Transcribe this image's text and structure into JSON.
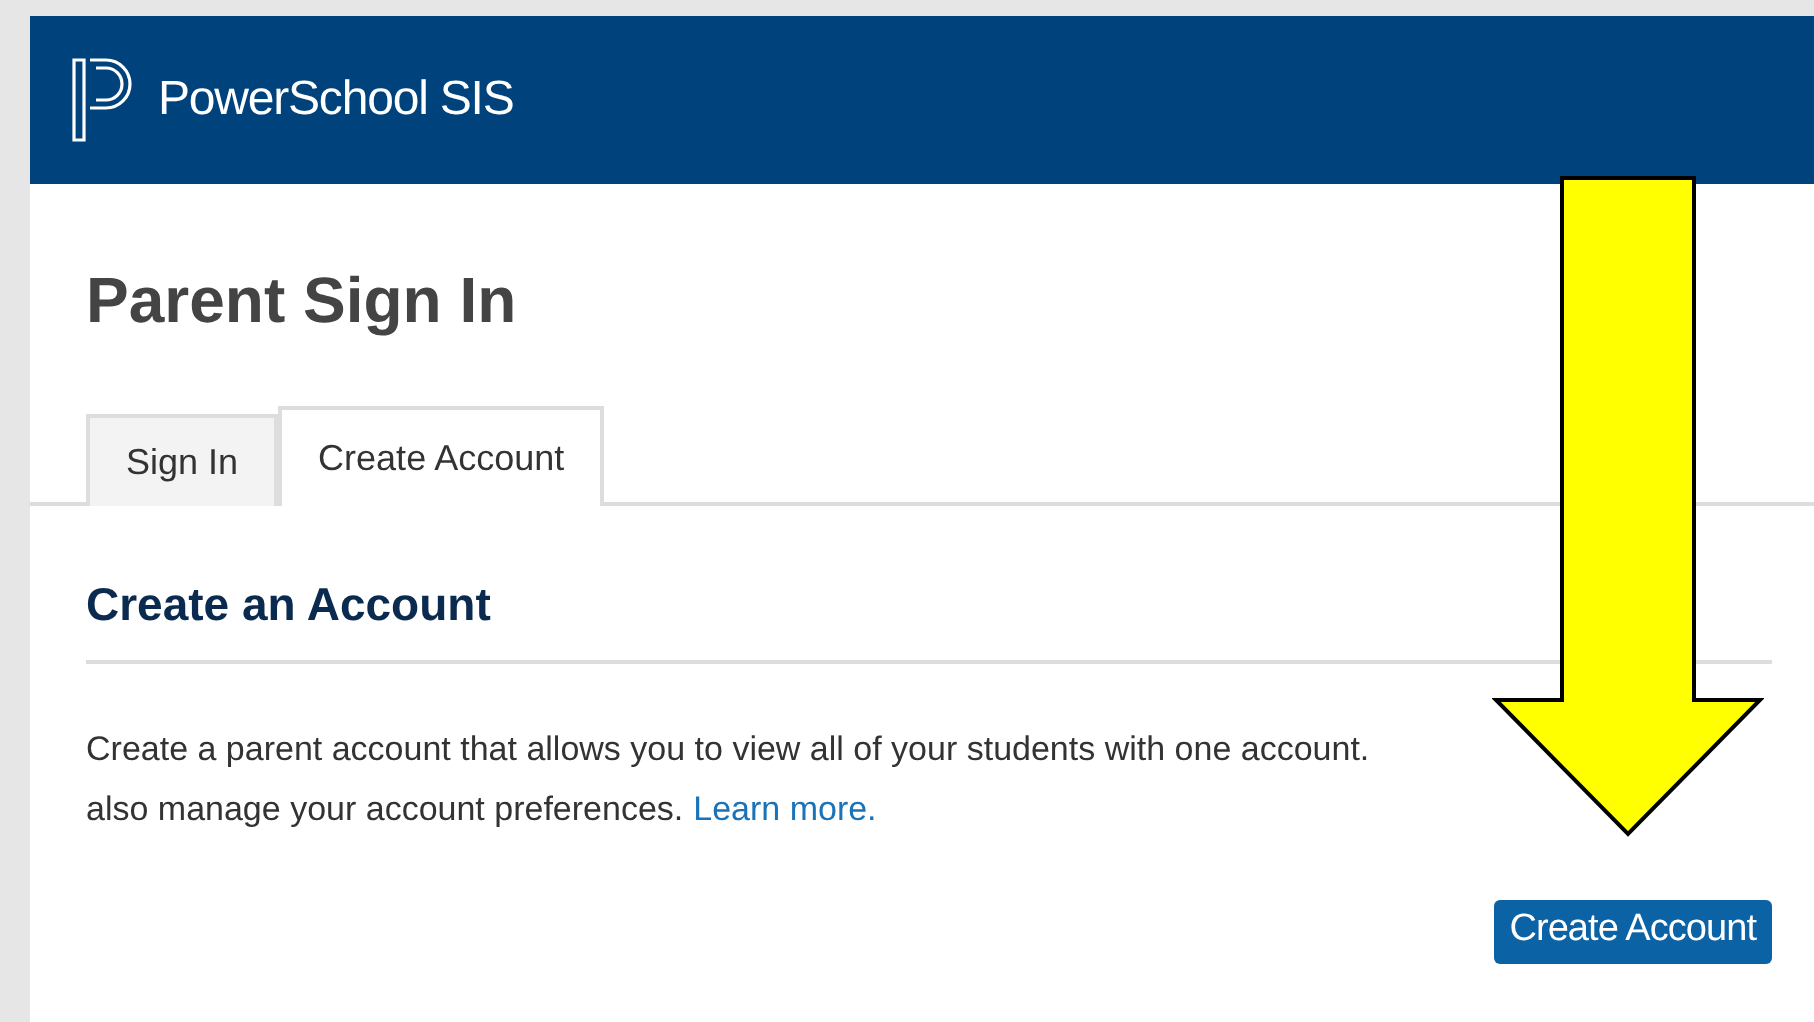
{
  "header": {
    "app_name": "PowerSchool SIS"
  },
  "page_title": "Parent Sign In",
  "tabs": [
    {
      "label": "Sign In",
      "selected": false
    },
    {
      "label": "Create Account",
      "selected": true
    }
  ],
  "section": {
    "heading": "Create an Account",
    "lines": [
      "Create a parent account that allows you to view all of your students with one account.",
      "also manage your account preferences."
    ],
    "link": "Learn more.",
    "button": "Create Account"
  },
  "annotation": {
    "kind": "arrow"
  }
}
